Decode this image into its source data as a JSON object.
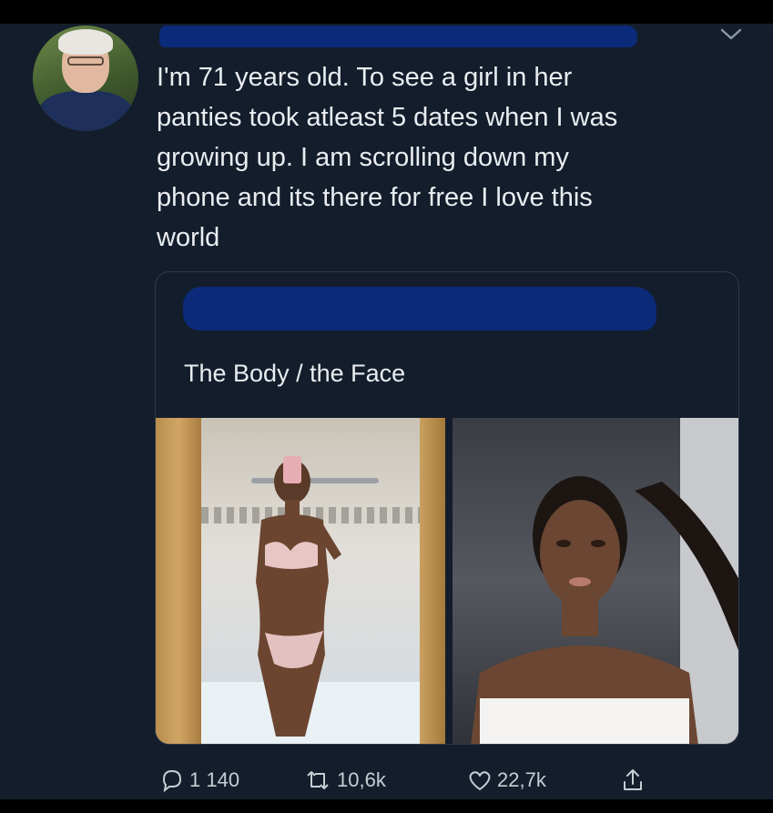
{
  "tweet": {
    "text": "I'm 71 years old. To see a girl in her\npanties took atleast 5 dates when I was\ngrowing up. I am scrolling down my\nphone and its there for free I love this\nworld"
  },
  "quoted": {
    "text": "The Body / the Face"
  },
  "actions": {
    "replies": "1 140",
    "retweets": "10,6k",
    "likes": "22,7k"
  },
  "icons": {
    "reply": "reply-bubble-icon",
    "retweet": "retweet-icon",
    "like": "heart-icon",
    "share": "share-icon",
    "menu": "chevron-down-icon"
  },
  "colors": {
    "background": "#141d2b",
    "text": "#e9edf1",
    "muted": "#c6cdd4",
    "redaction": "#0b2a7a"
  }
}
